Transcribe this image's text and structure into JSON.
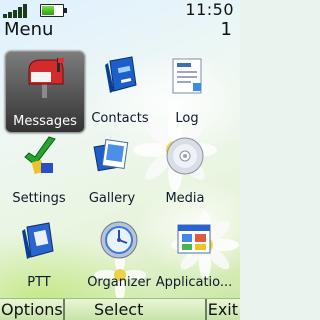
{
  "status": {
    "time": "11:50",
    "signal_icon": "signal-strength-icon",
    "battery_icon": "battery-icon",
    "battery_level": 0.6
  },
  "header": {
    "title": "Menu",
    "page_number": "1"
  },
  "menu": {
    "selected_index": 0,
    "items": [
      {
        "label": "Messages",
        "icon": "mailbox-icon"
      },
      {
        "label": "Contacts",
        "icon": "address-book-icon"
      },
      {
        "label": "Log",
        "icon": "document-log-icon"
      },
      {
        "label": "Settings",
        "icon": "settings-checkmark-icon"
      },
      {
        "label": "Gallery",
        "icon": "gallery-photos-icon"
      },
      {
        "label": "Media",
        "icon": "media-disc-icon"
      },
      {
        "label": "PTT",
        "icon": "ptt-book-icon"
      },
      {
        "label": "Organizer",
        "icon": "organizer-clock-icon"
      },
      {
        "label": "Applicatio...",
        "icon": "applications-window-icon"
      }
    ]
  },
  "softkeys": {
    "left": "Options",
    "middle": "Select",
    "right": "Exit"
  },
  "colors": {
    "softkey_bar": "#d6ecbb",
    "selection": "#555555",
    "text": "#111111"
  }
}
